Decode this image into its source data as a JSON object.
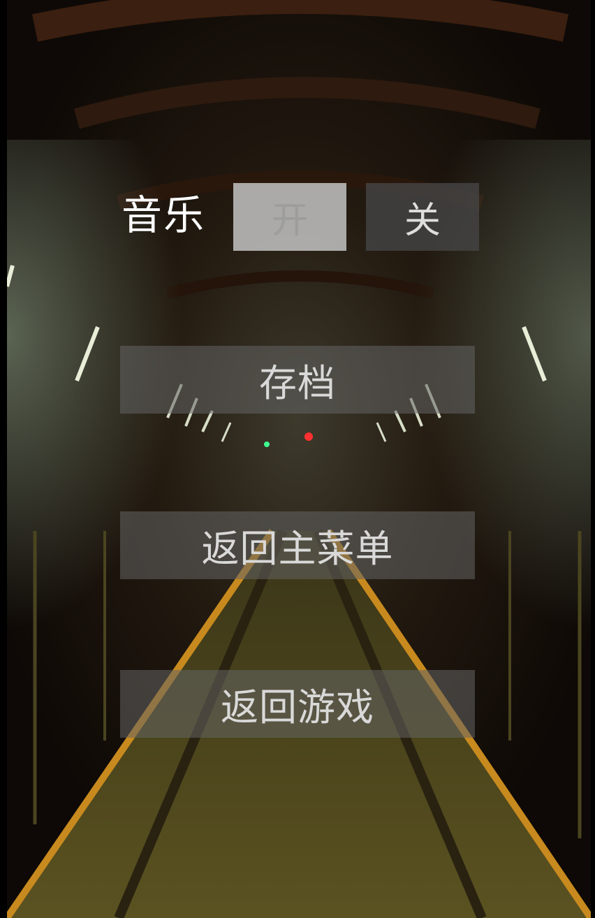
{
  "settings": {
    "music_label": "音乐",
    "music_on_label": "开",
    "music_off_label": "关",
    "music_state": "on"
  },
  "menu": {
    "save_label": "存档",
    "main_menu_label": "返回主菜单",
    "resume_label": "返回游戏"
  },
  "colors": {
    "toggle_selected_bg": "#bebebe",
    "toggle_unselected_bg": "#444444",
    "button_bg": "#646464",
    "text_light": "#d9d9d9",
    "track_stripe": "#c88a1e"
  }
}
